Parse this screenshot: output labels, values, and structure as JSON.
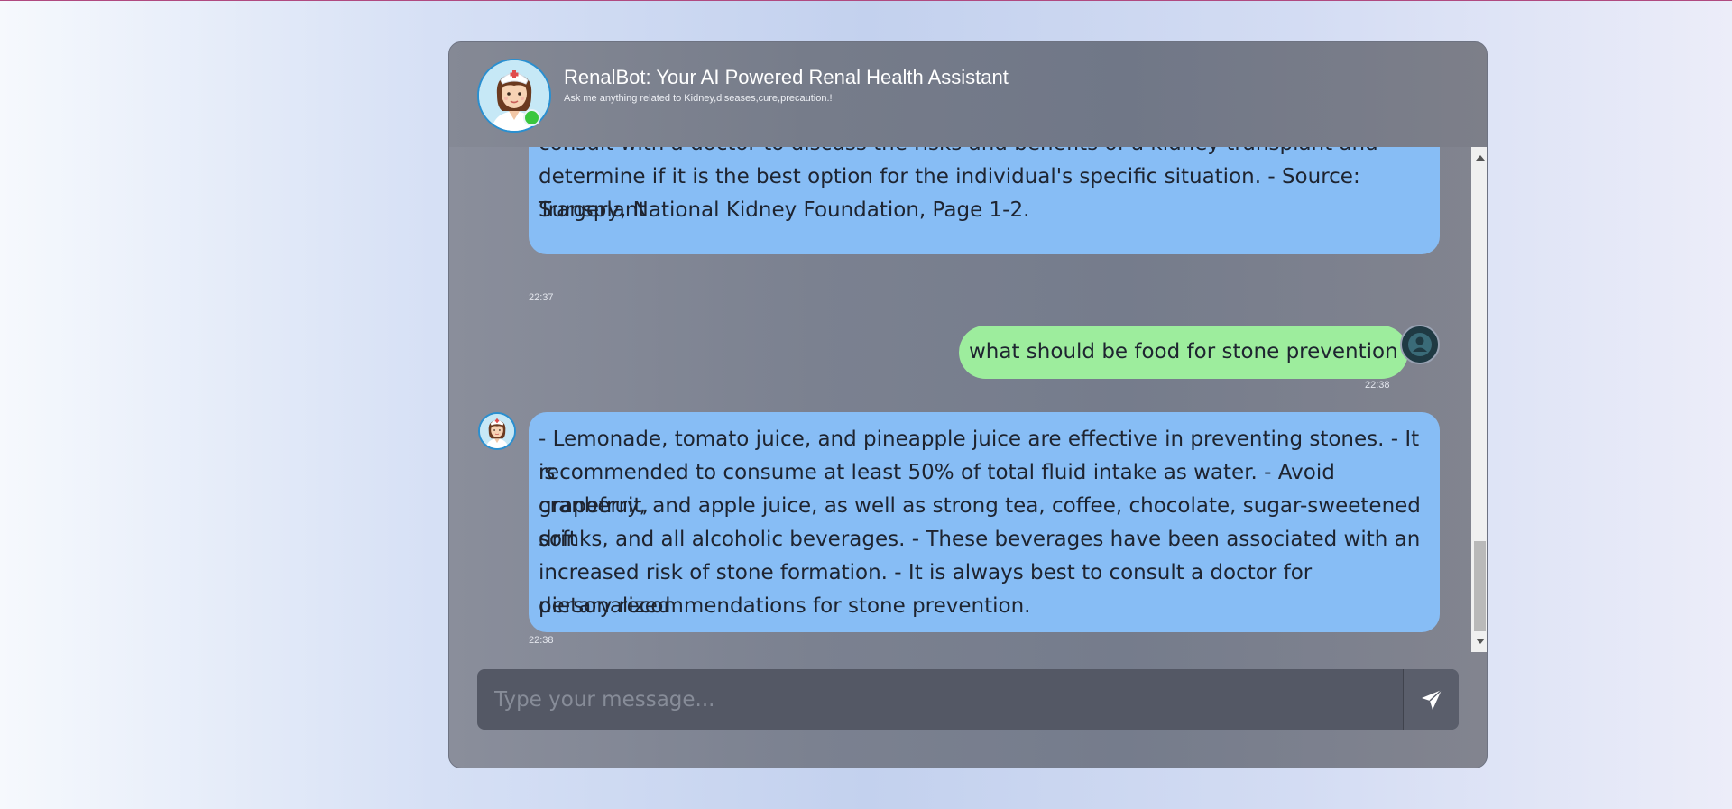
{
  "header": {
    "title": "RenalBot: Your AI Powered Renal Health Assistant",
    "subtitle": "Ask me anything related to Kidney,diseases,cure,precaution.!",
    "status": "online"
  },
  "messages": [
    {
      "sender": "bot",
      "lines": [
        "consult with a doctor to discuss the risks and benefits of a kidney transplant and",
        "determine if it is the best option for the individual's specific situation. - Source: Transplant",
        "Surgery, National Kidney Foundation, Page 1-2."
      ],
      "time": "22:37"
    },
    {
      "sender": "user",
      "text": "what should be food for stone prevention",
      "time": "22:38"
    },
    {
      "sender": "bot",
      "lines": [
        "- Lemonade, tomato juice, and pineapple juice are effective in preventing stones. - It is",
        "recommended to consume at least 50% of total fluid intake as water. - Avoid grapefruit,",
        "cranberry, and apple juice, as well as strong tea, coffee, chocolate, sugar-sweetened soft",
        "drinks, and all alcoholic beverages. - These beverages have been associated with an",
        "increased risk of stone formation. - It is always best to consult a doctor for personalized",
        "dietary recommendations for stone prevention."
      ],
      "time": "22:38"
    }
  ],
  "composer": {
    "placeholder": "Type your message...",
    "value": ""
  },
  "icons": {
    "send": "paper-plane-icon",
    "bot_avatar": "nurse-avatar-icon",
    "user_avatar": "user-avatar-icon"
  },
  "colors": {
    "bot_bubble": "#87bdf5",
    "user_bubble": "#9ded9d",
    "online": "#3ac73e"
  }
}
